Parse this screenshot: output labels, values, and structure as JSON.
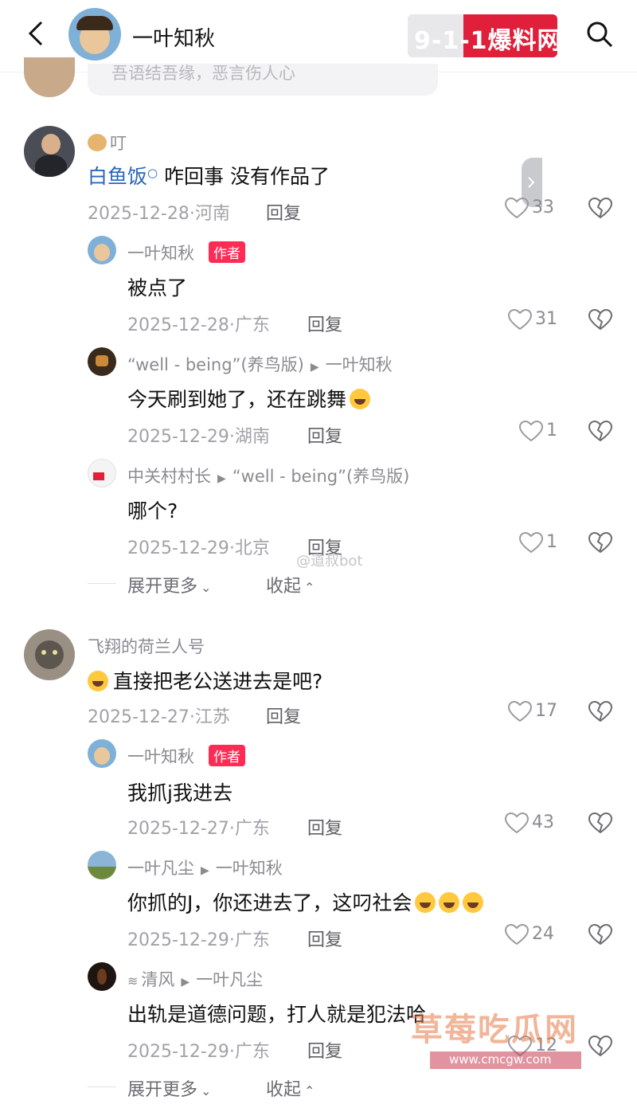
{
  "header": {
    "title": "一叶知秋",
    "search_placeholder": "吾语结吾缘，恶言伤人心",
    "watermark_brand": "9-1-1爆料网"
  },
  "threads": [
    {
      "name": "叮",
      "body_prefix": "白鱼饭",
      "body": " 咋回事 没有作品了",
      "meta": "2025-12-28·河南",
      "reply": "回复",
      "likes": "33"
    },
    {
      "name": "一叶知秋",
      "badge": "作者",
      "body": "被点了",
      "meta": "2025-12-28·广东",
      "reply": "回复",
      "likes": "31"
    },
    {
      "name": "“well - being”(养鸟版)",
      "target": "一叶知秋",
      "body": "今天刷到她了，还在跳舞",
      "meta": "2025-12-29·湖南",
      "reply": "回复",
      "likes": "1"
    },
    {
      "name": "中关村村长",
      "target": "“well - being”(养鸟版)",
      "body": "哪个?",
      "meta": "2025-12-29·北京",
      "reply": "回复",
      "likes": "1"
    },
    {
      "name": "飞翔的荷兰人号",
      "body": "直接把老公送进去是吧?",
      "meta": "2025-12-27·江苏",
      "reply": "回复",
      "likes": "17"
    },
    {
      "name": "一叶知秋",
      "badge": "作者",
      "body": "我抓j我进去",
      "meta": "2025-12-27·广东",
      "reply": "回复",
      "likes": "43"
    },
    {
      "name": "一叶凡尘",
      "target": "一叶知秋",
      "body": "你抓的J，你还进去了，这叼社会",
      "meta": "2025-12-29·广东",
      "reply": "回复",
      "likes": "24"
    },
    {
      "name": "清风",
      "target": "一叶凡尘",
      "body": "出轨是道德问题，打人就是犯法哈",
      "meta": "2025-12-29·广东",
      "reply": "回复",
      "likes": "12"
    }
  ],
  "expand_1": "展开更多",
  "collapse_1": "收起",
  "expand_2": "展开更多",
  "collapse_2": "收起",
  "watermark_weibo": "@道叔bot",
  "watermark_site": "草莓吃瓜网",
  "watermark_url": "www.cmcgw.com"
}
